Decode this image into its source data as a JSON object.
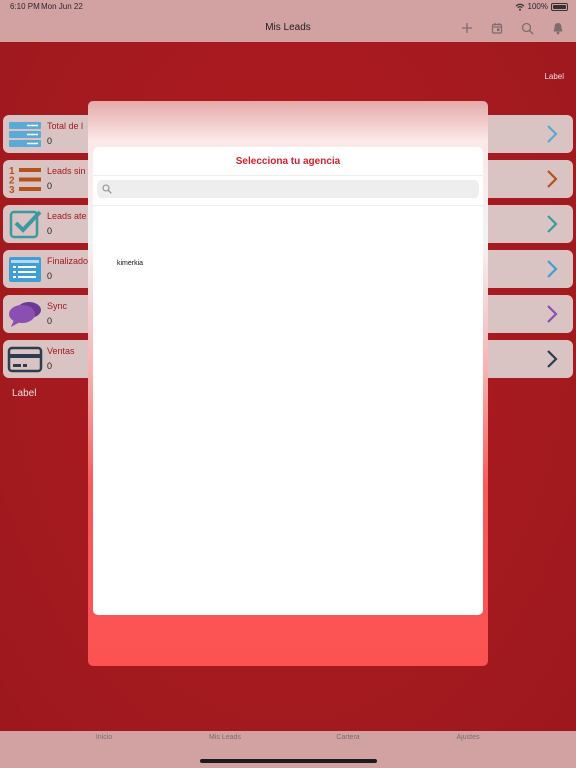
{
  "status": {
    "time": "6:10 PM",
    "date": "Mon Jun 22",
    "battery": "100%"
  },
  "nav": {
    "title": "Mis Leads",
    "icons": [
      "plus-icon",
      "calendar-icon",
      "search-icon",
      "bell-icon"
    ]
  },
  "main": {
    "top_label": "Label",
    "bottom_label": "Label",
    "rows": [
      {
        "name": "Total de l",
        "count": "0",
        "icon": "list-icon",
        "accent": "#5aa9d6"
      },
      {
        "name": "Leads sin",
        "count": "0",
        "icon": "numbered-list-icon",
        "accent": "#b4511d"
      },
      {
        "name": "Leads ate",
        "count": "0",
        "icon": "checkbox-icon",
        "accent": "#3a9aa0"
      },
      {
        "name": "Finalizado",
        "count": "0",
        "icon": "form-icon",
        "accent": "#3f9ed6"
      },
      {
        "name": "Sync",
        "count": "0",
        "icon": "chat-bubbles-icon",
        "accent": "#8a4fb0"
      },
      {
        "name": "Ventas",
        "count": "0",
        "icon": "credit-card-icon",
        "accent": "#2d3d4f"
      }
    ]
  },
  "modal": {
    "title": "Selecciona tu agencia",
    "search_placeholder": "",
    "options": [
      "kimerkia"
    ]
  },
  "tabbar": {
    "tabs": [
      "Inicio",
      "Mis Leads",
      "Cartera",
      "Ajustes"
    ]
  },
  "colors": {
    "brand_red": "#a51a1f",
    "title_red": "#d11f2b",
    "bar_pink": "#d2a1a2"
  }
}
